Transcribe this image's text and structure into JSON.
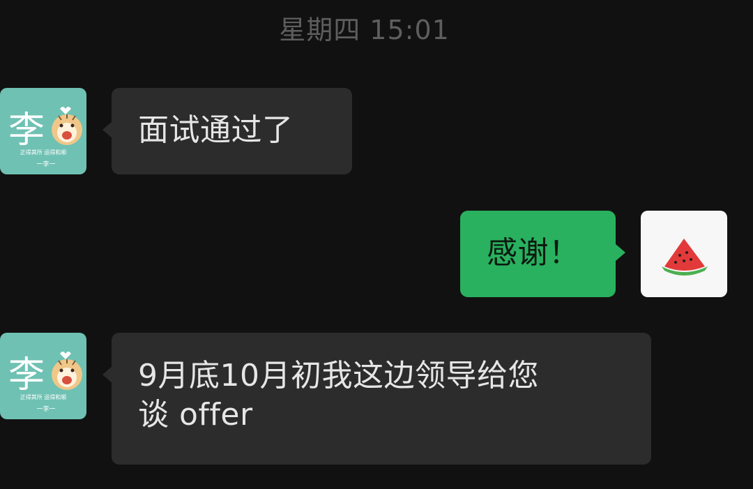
{
  "chat": {
    "timestamp": "星期四 15:01",
    "messages": [
      {
        "sender": "contact",
        "text": "面试通过了"
      },
      {
        "sender": "self",
        "text": "感谢！"
      },
      {
        "sender": "contact",
        "text": "9月底10月初我这边领导给您\n谈 offer"
      }
    ],
    "contact_avatar": {
      "initial": "李",
      "caption": "正得其所 运得和顺",
      "signature": "一李一",
      "icon": "tiger-cartoon-icon",
      "background": "#6fc1b3"
    },
    "self_avatar": {
      "icon": "watermelon-slice-icon",
      "background": "#f7f7f7"
    }
  },
  "colors": {
    "background": "#111111",
    "incoming_bubble": "#2c2c2c",
    "outgoing_bubble": "#29b15f",
    "timestamp_text": "#5e5e5e"
  }
}
